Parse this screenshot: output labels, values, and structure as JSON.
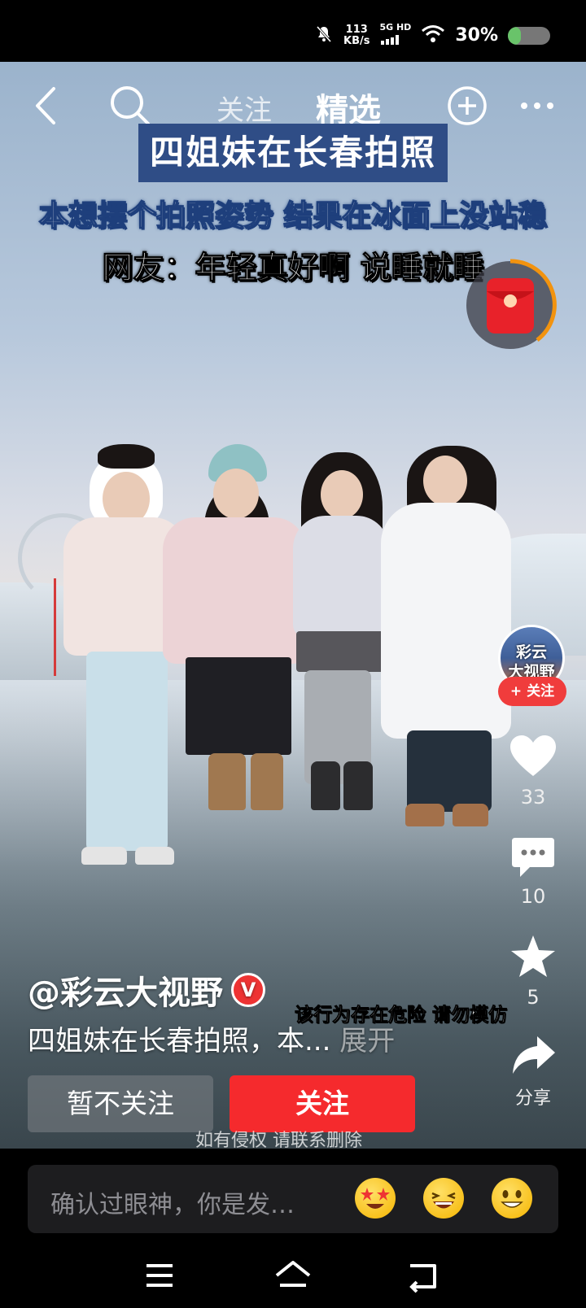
{
  "status_bar": {
    "net_speed_value": "113",
    "net_speed_unit": "KB/s",
    "network_type": "5G HD",
    "battery_percent": "30%",
    "battery_level": 0.3
  },
  "top_nav": {
    "tabs": [
      {
        "label": "关注",
        "active": false
      },
      {
        "label": "精选",
        "active": true
      }
    ],
    "icons": [
      "back-icon",
      "search-icon",
      "add-circle-icon",
      "more-icon"
    ]
  },
  "captions": {
    "title": "四姐妹在长春拍照",
    "line2": "本想摆个拍照姿势 结果在冰面上没站稳",
    "line3": "网友：年轻真好啊 说睡就睡",
    "warning": "该行为存在危险 请勿模仿",
    "copyright": "如有侵权 请联系删除"
  },
  "right_rail": {
    "avatar_text_line1": "彩云",
    "avatar_text_line2": "大视野",
    "follow_label": "+ 关注",
    "likes": "33",
    "comments": "10",
    "favorites": "5",
    "share_label": "分享"
  },
  "post": {
    "author": "@彩云大视野",
    "verified_badge": "V",
    "description": "四姐妹在长春拍照，本...",
    "expand_label": "展开"
  },
  "actions": {
    "unfollow_label": "暂不关注",
    "follow_label": "关注"
  },
  "comment_bar": {
    "placeholder": "确认过眼神，你是发…",
    "emojis": [
      "star-eyes-emoji",
      "laughing-emoji",
      "grinning-emoji"
    ]
  },
  "colors": {
    "accent_red": "#f52a2d",
    "caption_blue": "#2f4d86",
    "battery_green": "#69c36a"
  }
}
